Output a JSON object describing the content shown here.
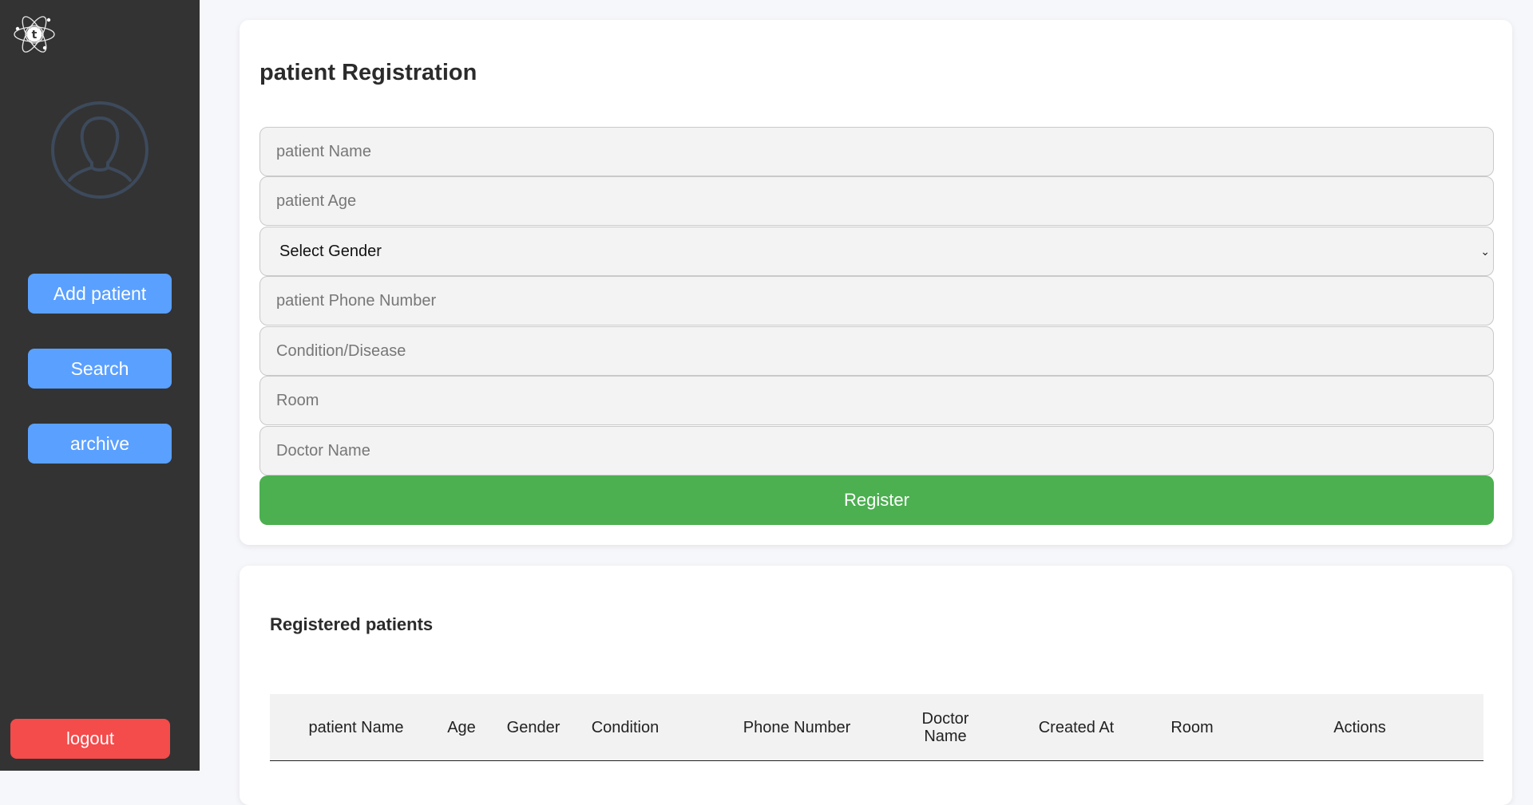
{
  "sidebar": {
    "logo": "atom-logo-icon",
    "avatar": "user-avatar-icon",
    "add_patient": "Add patient",
    "search": "Search",
    "archive": "archive",
    "logout": "logout"
  },
  "form": {
    "title": "patient Registration",
    "name_placeholder": "patient Name",
    "age_placeholder": "patient Age",
    "gender_selected": "Select Gender",
    "phone_placeholder": "patient Phone Number",
    "condition_placeholder": "Condition/Disease",
    "room_placeholder": "Room",
    "doctor_placeholder": "Doctor Name",
    "register_label": "Register"
  },
  "table": {
    "title": "Registered patients",
    "columns": [
      "patient Name",
      "Age",
      "Gender",
      "Condition",
      "Phone Number",
      "Doctor Name",
      "Created At",
      "Room",
      "Actions"
    ]
  },
  "colors": {
    "sidebar_bg": "#333333",
    "nav_button": "#5aa0ff",
    "logout_button": "#f44b4b",
    "register_button": "#4caf50"
  }
}
